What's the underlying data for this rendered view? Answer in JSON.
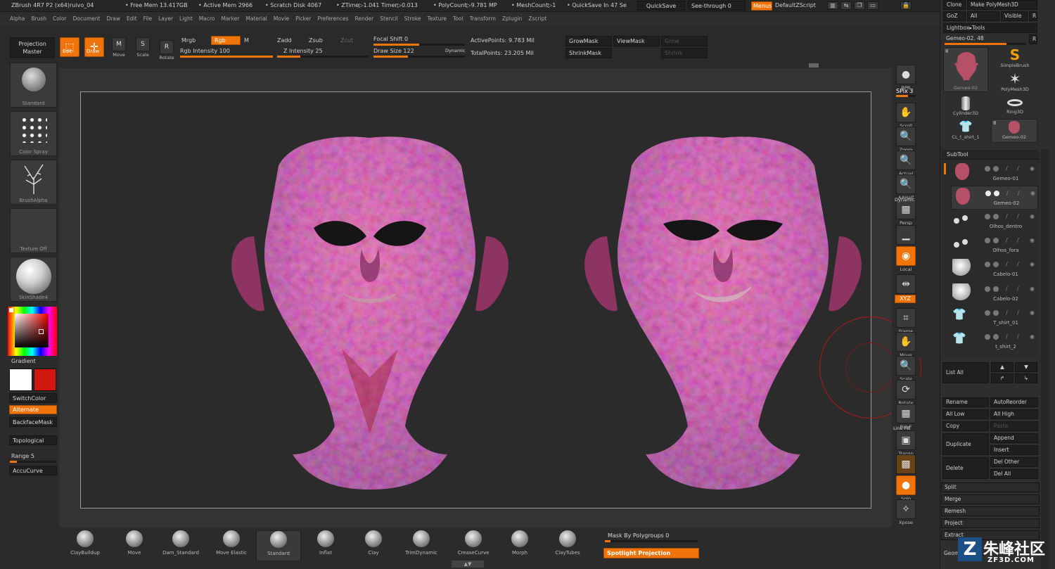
{
  "titlebar": {
    "app": "ZBrush 4R7 P2 (x64)ruivo_04",
    "free_mem": "• Free Mem 13.417GB",
    "active_mem": "• Active Mem 2966",
    "scratch": "• Scratch Disk 4067",
    "ztime": "• ZTime▷1.041 Timer▷0.013",
    "polycount": "• PolyCount▷9.781 MP",
    "meshcount": "• MeshCount▷1",
    "quicksave_info": "• QuickSave In 47 Se",
    "quicksave": "QuickSave",
    "see_through": "See-through  0",
    "menus": "Menus",
    "zscript": "DefaultZScript"
  },
  "menubar": [
    "Alpha",
    "Brush",
    "Color",
    "Document",
    "Draw",
    "Edit",
    "File",
    "Layer",
    "Light",
    "Macro",
    "Marker",
    "Material",
    "Movie",
    "Picker",
    "Preferences",
    "Render",
    "Stencil",
    "Stroke",
    "Texture",
    "Tool",
    "Transform",
    "Zplugin",
    "Zscript"
  ],
  "topshelf": {
    "projection": [
      "Projection",
      "Master"
    ],
    "edit": "Edit",
    "draw": "Draw",
    "move": "Move",
    "scale": "Scale",
    "rotate": "Rotate",
    "mrgb": "Mrgb",
    "rgb": "Rgb",
    "m": "M",
    "rgb_intensity": "Rgb Intensity 100",
    "zadd": "Zadd",
    "zsub": "Zsub",
    "zcut": "Zcut",
    "z_intensity": "Z Intensity 25",
    "focal_shift": "Focal Shift 0",
    "draw_size": "Draw Size 122",
    "dynamic": "Dynamic",
    "active_points": "ActivePoints: 9.783 Mil",
    "total_points": "TotalPoints: 23.205 Mil",
    "growmask": "GrowMask",
    "viewmask": "ViewMask",
    "grow": "Grow",
    "shrinkmask": "ShrinkMask",
    "shrink": "Shrink"
  },
  "leftshelf": {
    "brush": "Standard",
    "stroke": "Color Spray",
    "alpha": "BrushAlpha",
    "texture": "Texture Off",
    "material": "SkinShade4",
    "gradient": "Gradient",
    "switchcolor": "SwitchColor",
    "alternate": "Alternate",
    "backface": "BackfaceMask",
    "topological": "Topological",
    "range": "Range 5",
    "accucurve": "AccuCurve",
    "main_color": "#ffffff",
    "secondary_color": "#d0180f"
  },
  "rightshelf": [
    "BPR",
    "SPix 3",
    "Scroll",
    "Zoom",
    "Actual",
    "AAHalf",
    "Persp",
    "Floor",
    "Local",
    "L.Sym",
    "XYZ",
    "Frame",
    "Move",
    "Scale",
    "Rotate",
    "PolyF",
    "Transp",
    "Ghost",
    "Solo",
    "Xpose"
  ],
  "rightshelf_extra": {
    "dynamic": "Dynamic",
    "linefill": "Line Fill"
  },
  "bottomshelf": {
    "brushes": [
      "ClayBuildup",
      "Move",
      "Dam_Standard",
      "Move Elastic",
      "Standard",
      "Inflat",
      "Clay",
      "TrimDynamic",
      "CreaseCurve",
      "Morph",
      "ClayTubes"
    ],
    "mask_polygroups": "Mask By Polygroups 0",
    "spotlight": "Spotlight Projection"
  },
  "rightpanel": {
    "clone": "Clone",
    "make_polymesh": "Make PolyMesh3D",
    "goz": "GoZ",
    "all": "All",
    "visible": "Visible",
    "r": "R",
    "lightbox_tools": "Lightbox▸Tools",
    "current_tool": "Gemeo-02. 48",
    "tools": [
      "Gemeo-02",
      "SimpleBrush",
      "PolyMesh3D",
      "Cylinder3D",
      "Ring3D",
      "CL_t_shirt_1",
      "Gemeo-02"
    ],
    "tool_count_a": "8",
    "tool_count_b": "8",
    "subtool_title": "SubTool",
    "subtools": [
      "Gemeo-01",
      "Gemeo-02",
      "Olhos_dentro",
      "Olhos_fora",
      "Cabelo-01",
      "Cabelo-02",
      "T_shirt_01",
      "t_shirt_2"
    ],
    "list_all": "List All",
    "rename": "Rename",
    "autoreorder": "AutoReorder",
    "all_low": "All Low",
    "all_high": "All High",
    "copy": "Copy",
    "paste": "Paste",
    "duplicate": "Duplicate",
    "append": "Append",
    "insert": "Insert",
    "delete": "Delete",
    "del_other": "Del Other",
    "del_all": "Del All",
    "split": "Split",
    "merge": "Merge",
    "remesh": "Remesh",
    "project": "Project",
    "extract": "Extract",
    "geometry": "Geom"
  },
  "watermark": {
    "text": "朱峰社区",
    "url": "ZF3D.COM"
  }
}
